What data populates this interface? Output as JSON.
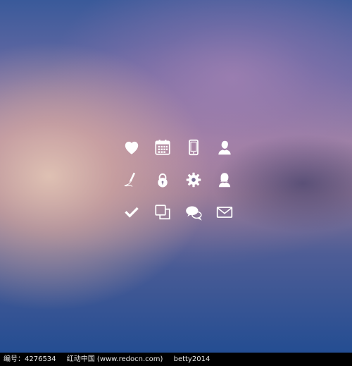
{
  "icons": [
    {
      "name": "heart-icon"
    },
    {
      "name": "calendar-icon"
    },
    {
      "name": "phone-icon"
    },
    {
      "name": "user-icon"
    },
    {
      "name": "pen-icon"
    },
    {
      "name": "lock-icon"
    },
    {
      "name": "gear-icon"
    },
    {
      "name": "user-female-icon"
    },
    {
      "name": "check-icon"
    },
    {
      "name": "copy-icon"
    },
    {
      "name": "chat-icon"
    },
    {
      "name": "mail-icon"
    }
  ],
  "footer": {
    "id_text": "编号：4276534",
    "site_text": "红动中国 (www.redocn.com)",
    "author_text": "betty2014"
  },
  "colors": {
    "icon": "#ffffff",
    "footer_bg": "#000000"
  }
}
